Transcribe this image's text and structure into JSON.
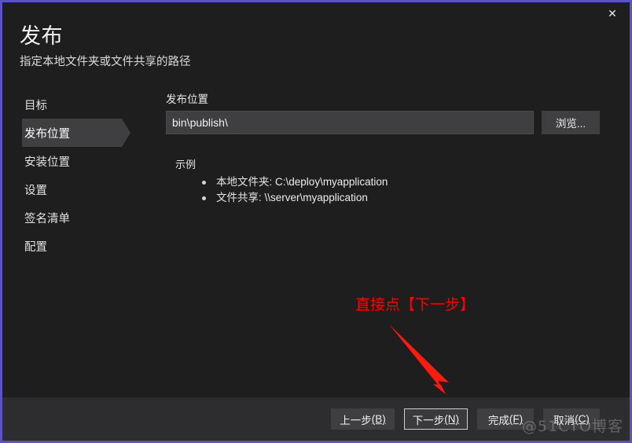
{
  "window": {
    "close_icon": "✕",
    "accent_border_color": "#5b52c4",
    "background_color": "#1e1e1e",
    "footer_color": "#2d2d30",
    "control_color": "#3f3f41"
  },
  "header": {
    "title": "发布",
    "subtitle": "指定本地文件夹或文件共享的路径"
  },
  "sidebar": {
    "items": [
      {
        "label": "目标",
        "selected": false
      },
      {
        "label": "发布位置",
        "selected": true
      },
      {
        "label": "安装位置",
        "selected": false
      },
      {
        "label": "设置",
        "selected": false
      },
      {
        "label": "签名清单",
        "selected": false
      },
      {
        "label": "配置",
        "selected": false
      }
    ]
  },
  "main": {
    "location_label": "发布位置",
    "location_value": "bin\\publish\\",
    "location_placeholder": "",
    "browse_label": "浏览...",
    "examples_title": "示例",
    "examples": [
      {
        "name": "本地文件夹:",
        "path": "C:\\deploy\\myapplication"
      },
      {
        "name": "文件共享:",
        "path": "\\\\server\\myapplication"
      }
    ]
  },
  "annotation": {
    "text": "直接点【下一步】",
    "color": "#ff0000"
  },
  "footer": {
    "buttons": [
      {
        "text": "上一步",
        "mnemonic": "(B)",
        "focused": false
      },
      {
        "text": "下一步",
        "mnemonic": "(N)",
        "focused": true
      },
      {
        "text": "完成",
        "mnemonic": "(F)",
        "focused": false
      },
      {
        "text": "取消",
        "mnemonic": "(C)",
        "focused": false
      }
    ]
  },
  "watermark": {
    "text": "@51CTO博客"
  }
}
